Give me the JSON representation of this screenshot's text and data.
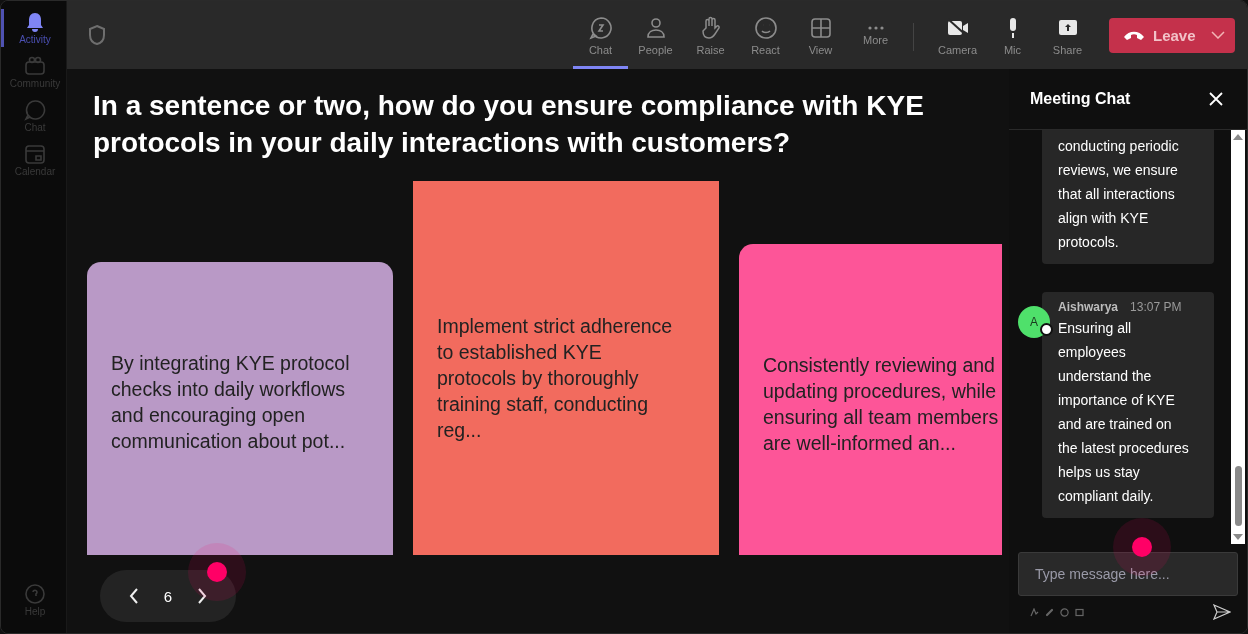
{
  "sidebar": {
    "items": [
      {
        "label": "Activity",
        "selected": true
      },
      {
        "label": "Community",
        "selected": false
      },
      {
        "label": "Chat",
        "selected": false
      },
      {
        "label": "Calendar",
        "selected": false
      }
    ],
    "help": {
      "label": "Help"
    }
  },
  "toolbar": {
    "items": [
      {
        "label": "Chat",
        "selected": true
      },
      {
        "label": "People",
        "selected": false
      },
      {
        "label": "Raise",
        "selected": false
      },
      {
        "label": "React",
        "selected": false
      },
      {
        "label": "View",
        "selected": false
      },
      {
        "label": "More",
        "selected": false
      },
      {
        "label": "Camera",
        "selected": false
      },
      {
        "label": "Mic",
        "selected": false
      },
      {
        "label": "Share",
        "selected": false
      }
    ],
    "leave": {
      "label": "Leave"
    }
  },
  "question": "In a sentence or two, how do you ensure compliance with KYE protocols in your daily interactions with customers?",
  "cards": [
    {
      "text": "By integrating KYE protocol checks into daily workflows and encouraging open communication about pot...",
      "color": "#b999c6"
    },
    {
      "text": "Implement strict adherence to established KYE protocols by thoroughly training staff, conducting reg...",
      "color": "#f26b5e"
    },
    {
      "text": "Consistently reviewing and updating procedures, while ensuring all team members are well-informed an...",
      "color": "#fd5598"
    }
  ],
  "pager": {
    "page": "6"
  },
  "chat": {
    "title": "Meeting Chat",
    "messages": [
      {
        "text": "conducting periodic reviews, we ensure that all interactions align with KYE protocols."
      },
      {
        "author": "Aishwarya",
        "initial": "A",
        "time": "13:07 PM",
        "text": "Ensuring all employees understand the importance of KYE and are trained on the latest procedures helps us stay compliant daily."
      }
    ],
    "input": {
      "placeholder": "Type message here..."
    }
  }
}
